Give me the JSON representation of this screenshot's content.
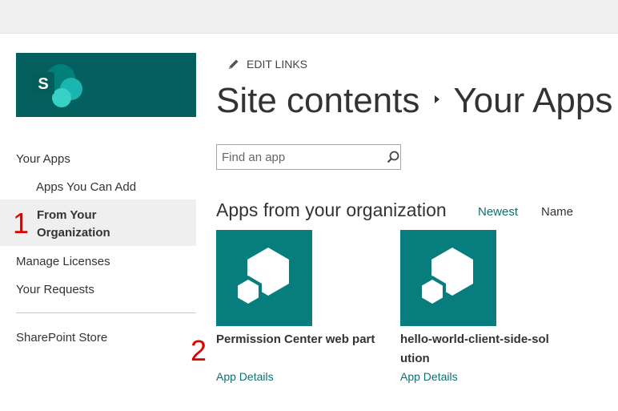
{
  "colors": {
    "brand_teal": "#03605e",
    "app_tile": "#077d7d",
    "link": "#0f6e6e",
    "marker": "#e00000",
    "selected_bg": "#efefef"
  },
  "logo": {
    "icon": "sharepoint-logo-icon",
    "letter": "S"
  },
  "nav": {
    "your_apps": "Your Apps",
    "apps_you_can_add": "Apps You Can Add",
    "from_your_org": "From Your Organization",
    "manage_licenses": "Manage Licenses",
    "your_requests": "Your Requests",
    "sharepoint_store": "SharePoint Store"
  },
  "markers": {
    "one": "1",
    "two": "2"
  },
  "header": {
    "edit_links": "EDIT LINKS",
    "breadcrumb_root": "Site contents",
    "breadcrumb_current": "Your Apps"
  },
  "search": {
    "placeholder": "Find an app",
    "value": ""
  },
  "section": {
    "title": "Apps from your organization",
    "sort_newest": "Newest",
    "sort_name": "Name"
  },
  "apps": [
    {
      "name": "Permission Center web part",
      "details_link": "App Details"
    },
    {
      "name": "hello-world-client-side-solution",
      "details_link": "App Details"
    }
  ]
}
